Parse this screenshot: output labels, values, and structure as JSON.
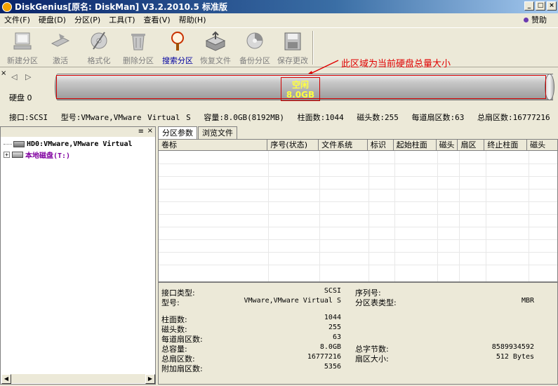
{
  "window": {
    "title": "DiskGenius[原名: DiskMan] V3.2.2010.5 标准版",
    "minimize": "_",
    "restore": "□",
    "close": "×",
    "sponsor": "赞助"
  },
  "menu": [
    "文件(F)",
    "硬盘(D)",
    "分区(P)",
    "工具(T)",
    "查看(V)",
    "帮助(H)"
  ],
  "toolbar": [
    {
      "label": "新建分区",
      "icon": "new-partition-icon"
    },
    {
      "label": "激活",
      "icon": "activate-icon"
    },
    {
      "label": "格式化",
      "icon": "format-icon"
    },
    {
      "label": "删除分区",
      "icon": "delete-partition-icon"
    },
    {
      "label": "搜索分区",
      "icon": "search-partition-icon"
    },
    {
      "label": "恢复文件",
      "icon": "recover-files-icon"
    },
    {
      "label": "备份分区",
      "icon": "backup-partition-icon"
    },
    {
      "label": "保存更改",
      "icon": "save-changes-icon"
    }
  ],
  "annotation": "此区域为当前硬盘总量大小",
  "diskbar": {
    "close": "×",
    "arrows": "◁ ▷",
    "disk_label": "硬盘 0",
    "free_label": "空闲",
    "free_size": "8.0GB",
    "info": {
      "interface": "接口:SCSI",
      "model": "型号:VMware,VMware Virtual S",
      "capacity": "容量:8.0GB(8192MB)",
      "cylinders": "柱面数:1044",
      "heads": "磁头数:255",
      "sectors_per_track": "每道扇区数:63",
      "total_sectors": "总扇区数:16777216"
    }
  },
  "tree": {
    "header_close": "×",
    "header_handle": "≡",
    "items": [
      {
        "label": "HD0:VMware,VMware Virtual",
        "color": "#000000"
      },
      {
        "label": "本地磁盘(T:)",
        "color": "#8000a0"
      }
    ]
  },
  "tabs": [
    "分区参数",
    "浏览文件"
  ],
  "columns": [
    "卷标",
    "序号(状态)",
    "文件系统",
    "标识",
    "起始柱面",
    "磁头",
    "扇区",
    "终止柱面",
    "磁头"
  ],
  "scroll": {
    "left": "◀",
    "right": "▶"
  },
  "details": {
    "left": [
      {
        "key": "接口类型:",
        "value": "SCSI"
      },
      {
        "key": "型号:",
        "value": "VMware,VMware Virtual S"
      },
      {
        "key": "柱面数:",
        "value": "1044"
      },
      {
        "key": "磁头数:",
        "value": "255"
      },
      {
        "key": "每道扇区数:",
        "value": "63"
      },
      {
        "key": "总容量:",
        "value": "8.0GB"
      },
      {
        "key": "总扇区数:",
        "value": "16777216"
      },
      {
        "key": "附加扇区数:",
        "value": "5356"
      }
    ],
    "right": [
      {
        "key": "序列号:",
        "value": ""
      },
      {
        "key": "分区表类型:",
        "value": "MBR"
      },
      {
        "key": "总字节数:",
        "value": "8589934592"
      },
      {
        "key": "扇区大小:",
        "value": "512 Bytes"
      }
    ]
  }
}
